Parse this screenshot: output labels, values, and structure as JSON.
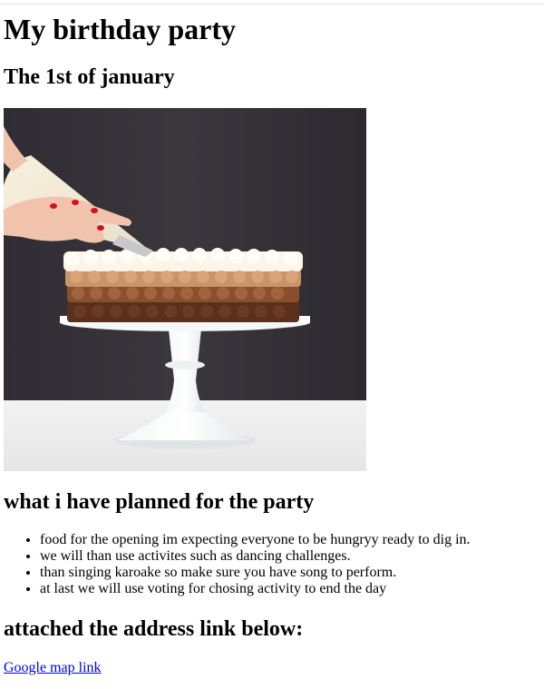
{
  "page": {
    "title": "My birthday party",
    "date": "The 1st of january"
  },
  "photo": {
    "description_icon": "cake-photo"
  },
  "plans": {
    "heading": "what i have planned for the party",
    "items": [
      "food for the opening im expecting everyone to be hungryy ready to dig in.",
      "we will than use activites such as dancing challenges.",
      "than singing karoake so make sure you have song to perform.",
      "at last we will use voting for chosing activity to end the day"
    ]
  },
  "address": {
    "heading": "attached the address link below:",
    "link_label": "Google map link"
  },
  "colors": {
    "link": "#0000ee",
    "text": "#000000",
    "background": "#ffffff"
  }
}
